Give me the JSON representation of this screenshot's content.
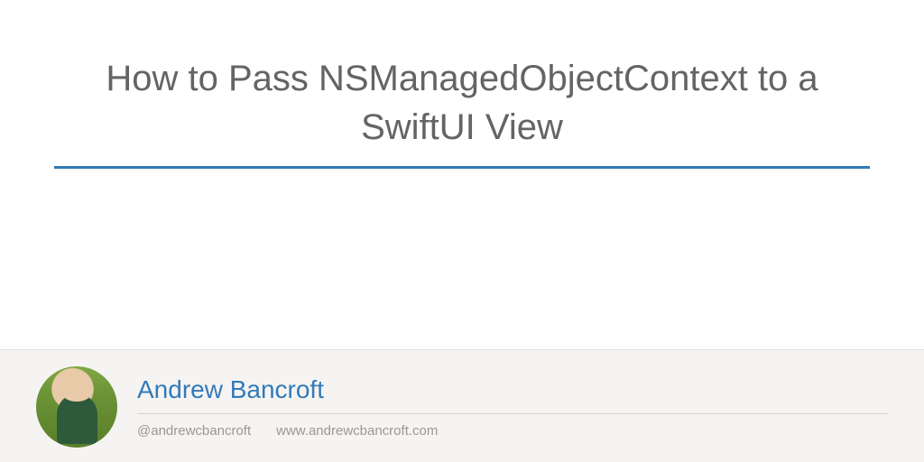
{
  "title": "How to Pass NSManagedObjectContext to a SwiftUI View",
  "author": {
    "name": "Andrew Bancroft",
    "handle": "@andrewcbancroft",
    "website": "www.andrewcbancroft.com"
  }
}
